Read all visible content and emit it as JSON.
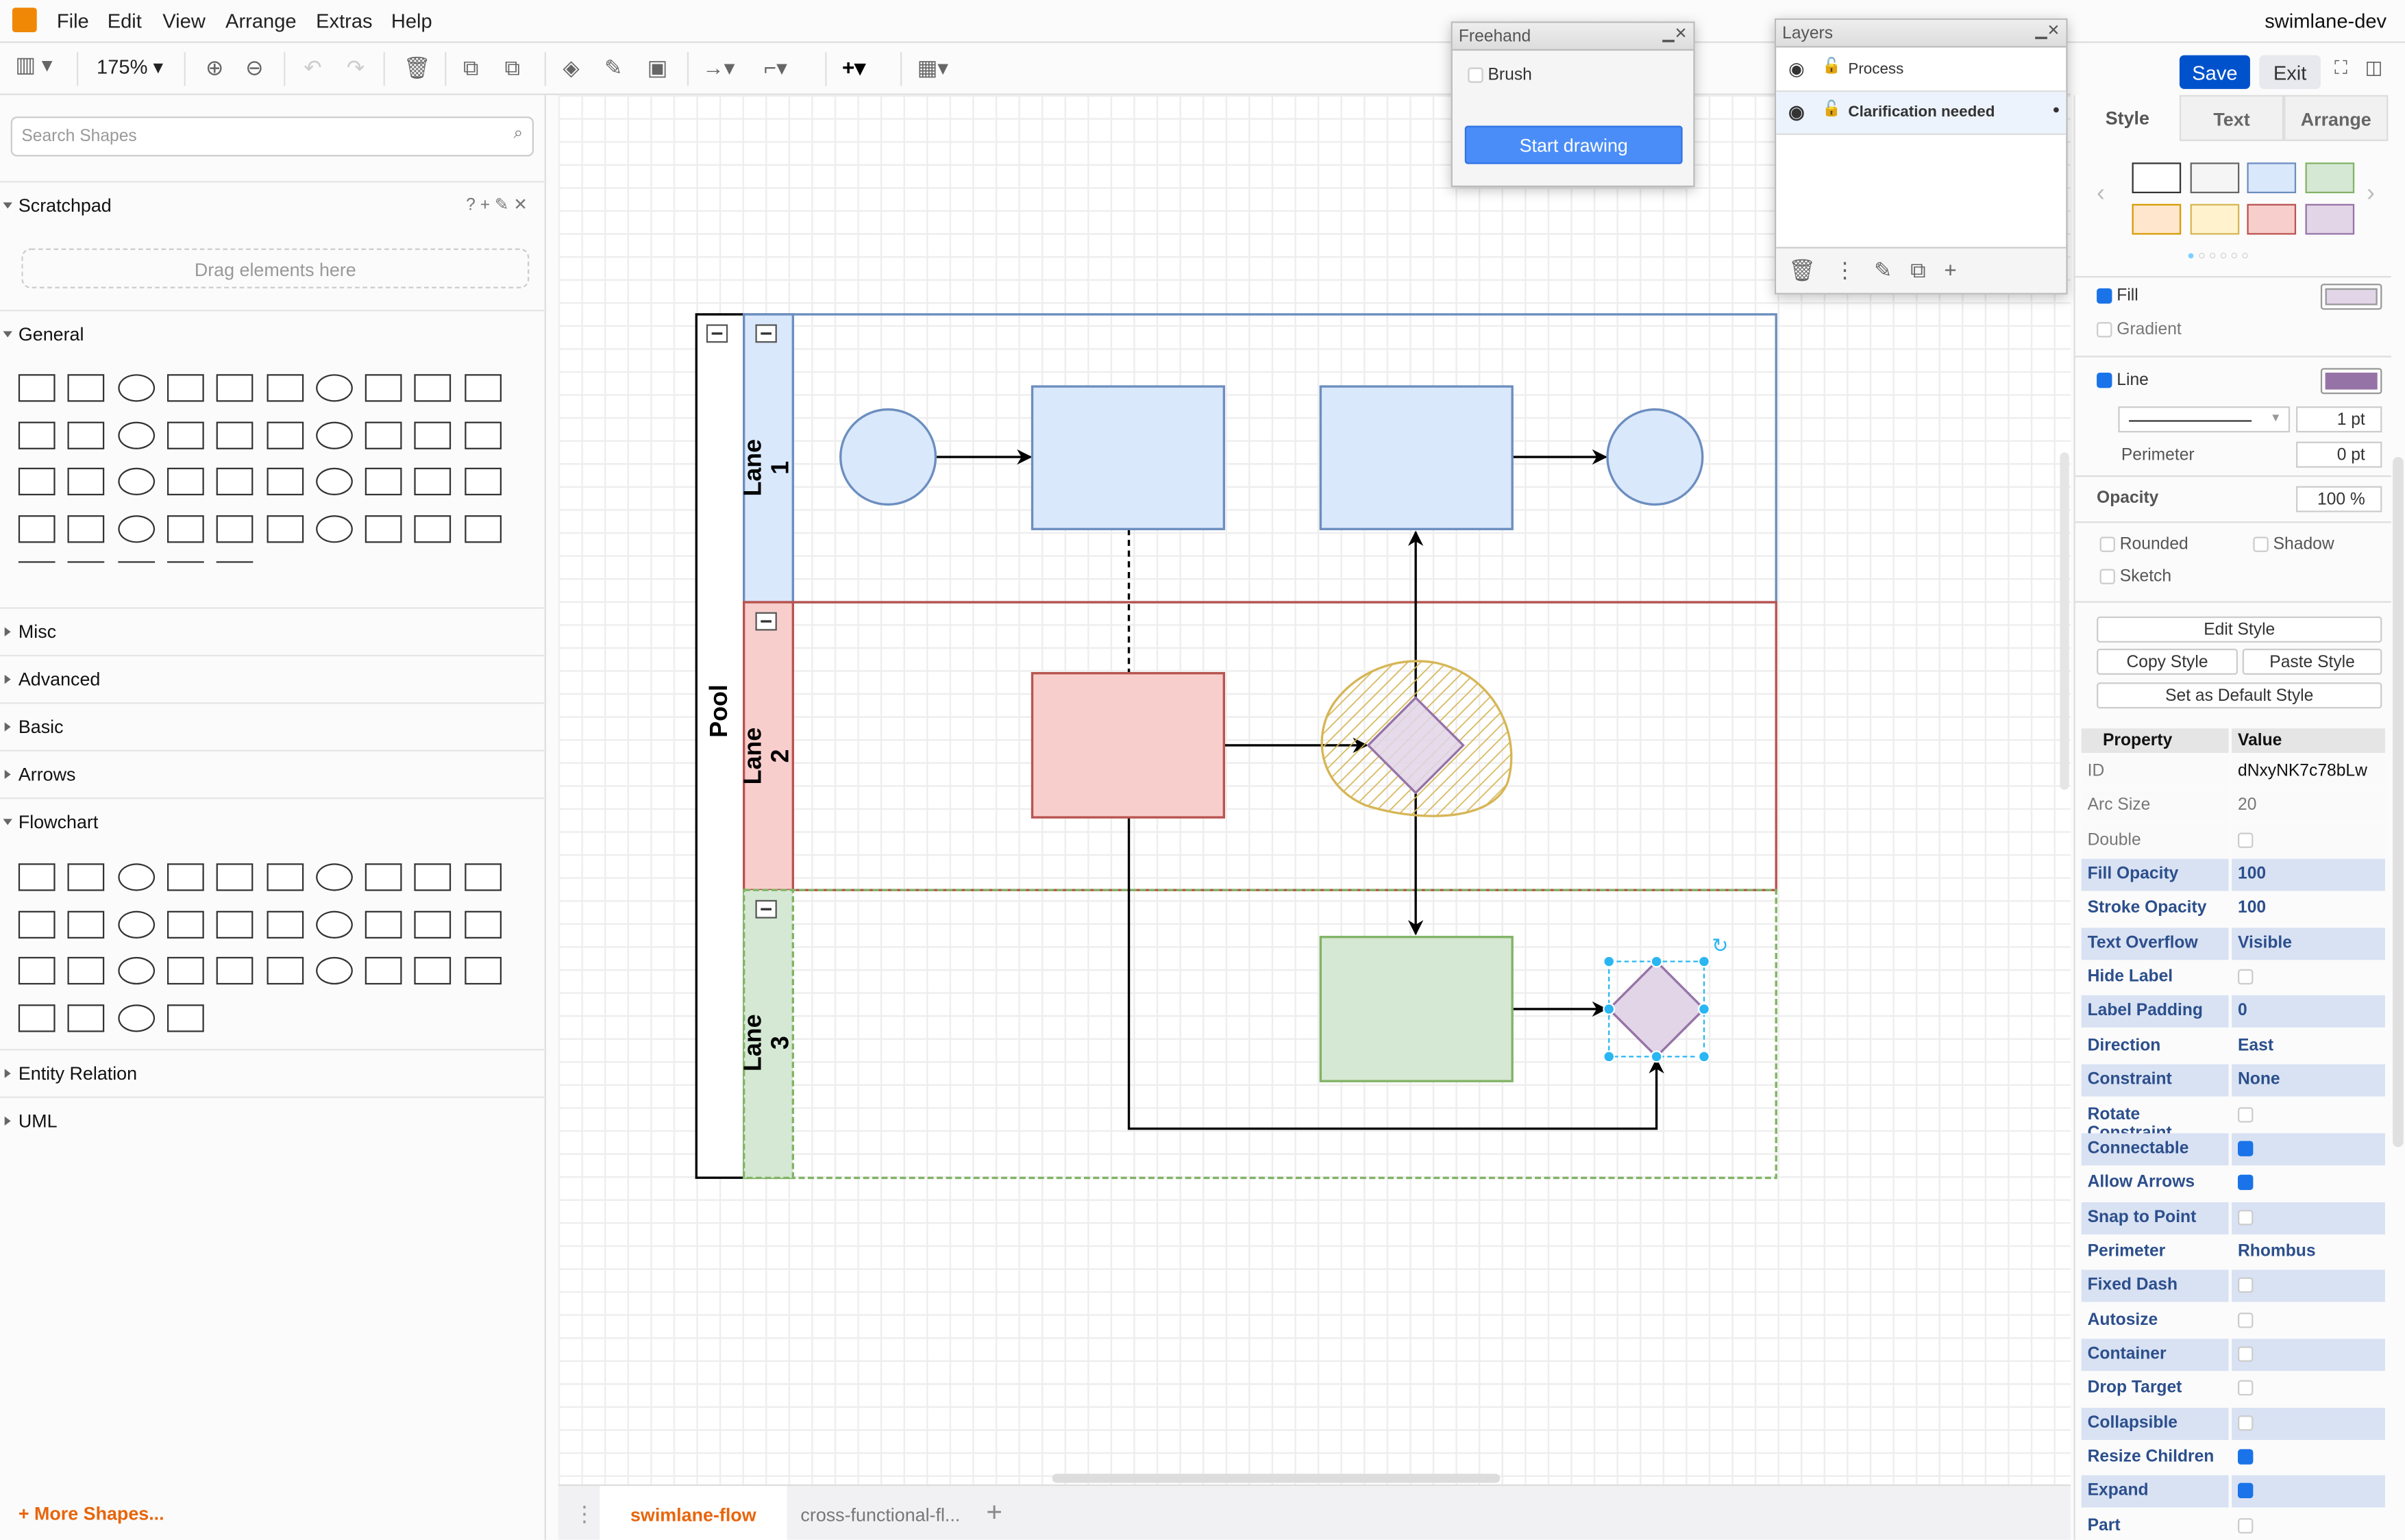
{
  "app": {
    "title": "swimlane-dev",
    "menu": [
      "File",
      "Edit",
      "View",
      "Arrange",
      "Extras",
      "Help"
    ]
  },
  "toolbar": {
    "zoom": "175%",
    "icons": [
      "format-panel-icon",
      "zoom-in-icon",
      "zoom-out-icon",
      "undo-icon",
      "redo-icon",
      "delete-icon",
      "to-front-icon",
      "to-back-icon",
      "fill-color-icon",
      "line-color-icon",
      "shadow-icon",
      "connection-icon",
      "waypoints-icon",
      "insert-icon",
      "table-icon"
    ]
  },
  "sidebar": {
    "search_placeholder": "Search Shapes",
    "scratchpad": "Scratchpad",
    "scratch_hint": "Drag elements here",
    "scratch_icons": "? + ✎ ✕",
    "sections": [
      "General",
      "Misc",
      "Advanced",
      "Basic",
      "Arrows",
      "Flowchart",
      "Entity Relation",
      "UML"
    ],
    "more_shapes": "More Shapes..."
  },
  "freehand": {
    "title": "Freehand",
    "brush": "Brush",
    "start": "Start drawing"
  },
  "layers": {
    "title": "Layers",
    "items": [
      {
        "name": "Process",
        "selected": false
      },
      {
        "name": "Clarification needed",
        "selected": true
      }
    ]
  },
  "diagram": {
    "pool": "Pool",
    "lanes": [
      {
        "label": "Lane 1",
        "fill": "#dae8fc",
        "stroke": "#6c8ebf"
      },
      {
        "label": "Lane 2",
        "fill": "#f8cecc",
        "stroke": "#b85450"
      },
      {
        "label": "Lane 3",
        "fill": "#d5e8d4",
        "stroke": "#82b366"
      }
    ],
    "purple_fill": "#e1d5e7",
    "purple_stroke": "#9673a6",
    "hatch_color": "#d6b656"
  },
  "format": {
    "save": "Save",
    "exit": "Exit",
    "tabs": [
      "Style",
      "Text",
      "Arrange"
    ],
    "swatches": [
      [
        "#ffffff",
        "#333333"
      ],
      [
        "#f5f5f5",
        "#666666"
      ],
      [
        "#dae8fc",
        "#6c8ebf"
      ],
      [
        "#d5e8d4",
        "#82b366"
      ],
      [
        "#ffe6cc",
        "#d79b00"
      ],
      [
        "#fff2cc",
        "#d6b656"
      ],
      [
        "#f8cecc",
        "#b85450"
      ],
      [
        "#e1d5e7",
        "#9673a6"
      ]
    ],
    "fill": "Fill",
    "gradient": "Gradient",
    "line": "Line",
    "line_width": "1 pt",
    "perimeter": "Perimeter",
    "perimeter_value": "0 pt",
    "opacity": "Opacity",
    "opacity_value": "100 %",
    "rounded": "Rounded",
    "shadow": "Shadow",
    "sketch": "Sketch",
    "edit_style": "Edit Style",
    "copy_style": "Copy Style",
    "paste_style": "Paste Style",
    "set_default": "Set as Default Style",
    "fill_color": "#e1d5e7",
    "line_color": "#9673a6"
  },
  "properties": {
    "header": [
      "Property",
      "Value"
    ],
    "rows": [
      {
        "k": "ID",
        "v": "dNxyNK7c78bLw"
      },
      {
        "k": "Arc Size",
        "v": "20"
      },
      {
        "k": "Double",
        "cb": false
      },
      {
        "k": "Fill Opacity",
        "v": "100",
        "b": 1
      },
      {
        "k": "Stroke Opacity",
        "v": "100",
        "b": 1
      },
      {
        "k": "Text Overflow",
        "v": "Visible",
        "b": 1
      },
      {
        "k": "Hide Label",
        "cb": false,
        "b": 1
      },
      {
        "k": "Label Padding",
        "v": "0",
        "b": 1
      },
      {
        "k": "Direction",
        "v": "East",
        "b": 1
      },
      {
        "k": "Constraint",
        "v": "None",
        "b": 1
      },
      {
        "k": "Rotate Constraint",
        "cb": false,
        "b": 1
      },
      {
        "k": "Connectable",
        "cb": true,
        "b": 1
      },
      {
        "k": "Allow Arrows",
        "cb": true,
        "b": 1
      },
      {
        "k": "Snap to Point",
        "cb": false,
        "b": 1
      },
      {
        "k": "Perimeter",
        "v": "Rhombus",
        "b": 1
      },
      {
        "k": "Fixed Dash",
        "cb": false,
        "b": 1
      },
      {
        "k": "Autosize",
        "cb": false,
        "b": 1
      },
      {
        "k": "Container",
        "cb": false,
        "b": 1
      },
      {
        "k": "Drop Target",
        "cb": false,
        "b": 1
      },
      {
        "k": "Collapsible",
        "cb": false,
        "b": 1
      },
      {
        "k": "Resize Children",
        "cb": true,
        "b": 1
      },
      {
        "k": "Expand",
        "cb": true,
        "b": 1
      },
      {
        "k": "Part",
        "cb": false,
        "b": 1
      }
    ]
  },
  "pages": {
    "tabs": [
      {
        "label": "swimlane-flow",
        "active": true
      },
      {
        "label": "cross-functional-fl..."
      }
    ],
    "add": "+"
  }
}
